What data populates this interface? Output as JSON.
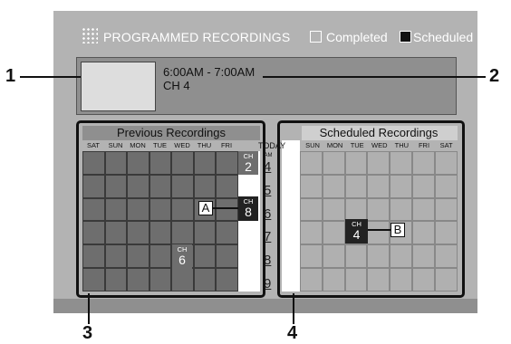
{
  "header": {
    "title": "PROGRAMMED RECORDINGS",
    "legend_completed": "Completed",
    "legend_scheduled": "Scheduled"
  },
  "info": {
    "time": "6:00AM - 7:00AM",
    "channel": "CH 4"
  },
  "callouts": [
    "1",
    "2",
    "3",
    "4"
  ],
  "previous": {
    "title": "Previous Recordings",
    "days": [
      "SAT",
      "SUN",
      "MON",
      "TUE",
      "WED",
      "THU",
      "FRI"
    ]
  },
  "today": {
    "label": "TODAY",
    "am": "AM",
    "hours": [
      "4",
      "5",
      "6",
      "7",
      "8",
      "9"
    ]
  },
  "scheduled": {
    "title": "Scheduled Recordings",
    "days": [
      "SUN",
      "MON",
      "TUE",
      "WED",
      "THU",
      "FRI",
      "SAT"
    ]
  },
  "recordings": {
    "ch_prefix": "CH",
    "today_ch": "2",
    "prev_a_ch": "8",
    "prev_wed_ch": "6",
    "sched_ch": "4"
  },
  "tags": {
    "a": "A",
    "b": "B"
  },
  "colors": {
    "completed": "#6e6e6e",
    "scheduled": "#b0b0b0",
    "marker": "#222222"
  }
}
